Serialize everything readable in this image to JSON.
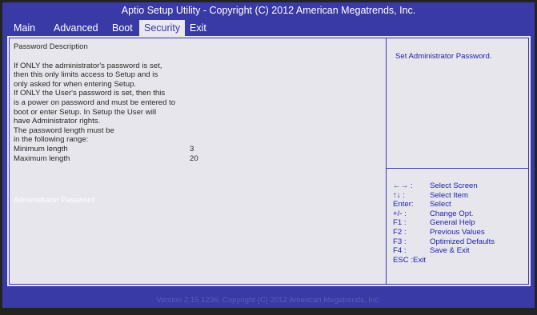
{
  "title": "Aptio Setup Utility - Copyright (C) 2012 American Megatrends, Inc.",
  "tabs": [
    {
      "label": "Main"
    },
    {
      "label": "Advanced"
    },
    {
      "label": "Boot"
    },
    {
      "label": "Security"
    },
    {
      "label": "Exit"
    }
  ],
  "left_panel": {
    "heading": "Password Description",
    "lines": [
      "If ONLY the administrator's password is set,",
      "then this only limits access to Setup and is",
      "only asked for when entering Setup.",
      "If ONLY the User's password is set, then this",
      "is a power on password and must be entered to",
      "boot or enter Setup.  In Setup the User will",
      "have Administrator rights.",
      "The password length must be",
      "in the following range:"
    ],
    "min_label": "Minimum length",
    "min_value": "3",
    "max_label": "Maximum length",
    "max_value": "20",
    "admin_password": "Administrator Password"
  },
  "help": {
    "text": "Set Administrator Password."
  },
  "keys": [
    {
      "key": "←→ :",
      "desc": "Select Screen"
    },
    {
      "key": "↑↓  :",
      "desc": "Select Item"
    },
    {
      "key": "Enter:",
      "desc": "Select"
    },
    {
      "key": "+/- :",
      "desc": "Change Opt."
    },
    {
      "key": "F1 :",
      "desc": "General Help"
    },
    {
      "key": "F2 :",
      "desc": "Previous Values"
    },
    {
      "key": "F3 :",
      "desc": "Optimized Defaults"
    },
    {
      "key": "F4 :",
      "desc": "Save & Exit"
    },
    {
      "key": "ESC :Exit",
      "desc": ""
    }
  ],
  "footer": "Version 2.15.1236. Copyright (C) 2012 American Megatrends, Inc.",
  "colors": {
    "frame": "#3a3aa6",
    "panel": "#e6e6ec",
    "help_text": "#2222aa",
    "footer_text": "#5b5bb8"
  }
}
